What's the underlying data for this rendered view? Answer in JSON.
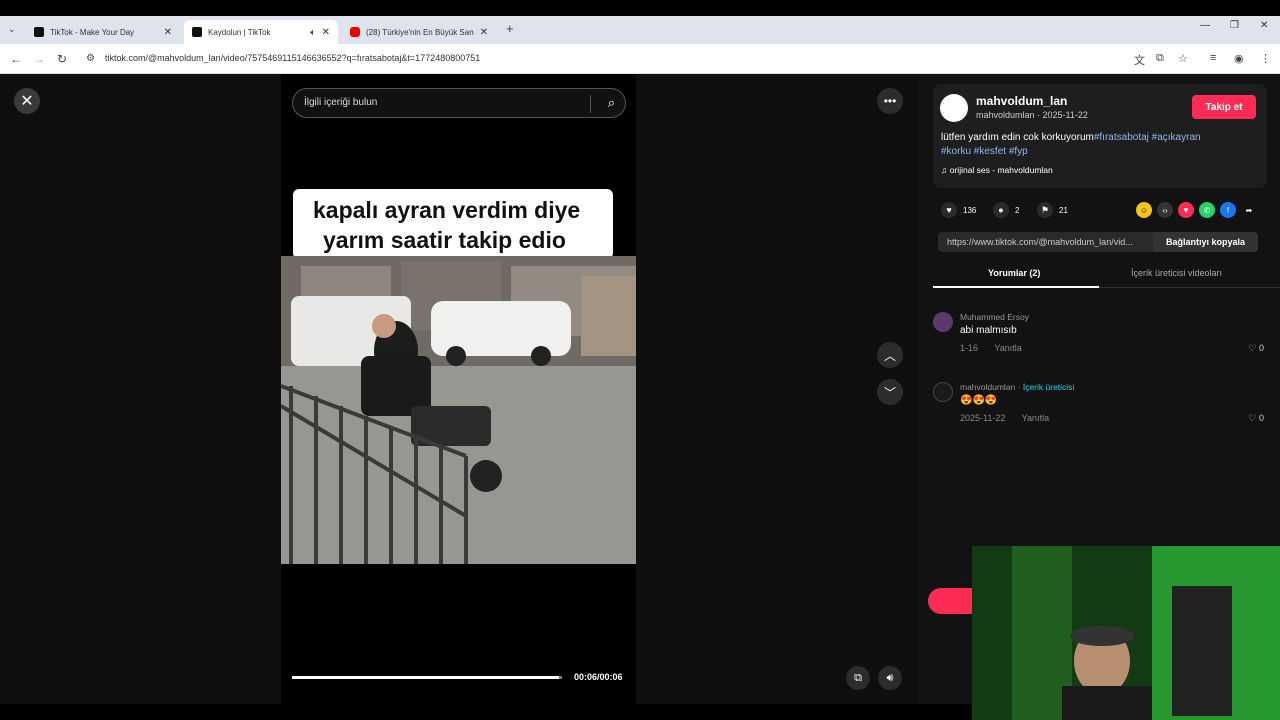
{
  "browser": {
    "tabs": [
      {
        "title": "TikTok - Make Your Day"
      },
      {
        "title": "Kaydolun | TikTok"
      },
      {
        "title": "(28) Türkiye'nin En Büyük Sand"
      }
    ],
    "new_tab": "+",
    "url": "tiktok.com/@mahvoldum_lan/video/7575469115146636552?q=fıratsabotaj&t=1772480800751"
  },
  "player": {
    "search_placeholder": "İlgili içeriği bulun",
    "caption_line1": "kapalı ayran verdim diye",
    "caption_line2": "yarım saatir takip edio",
    "time": "00:06/00:06",
    "progress": 0.99
  },
  "profile": {
    "username": "mahvoldum_lan",
    "subline": "mahvoldumlan · 2025-11-22",
    "follow_label": "Takip et",
    "description": "lütfen yardım edin cok korkuyorum",
    "hashtags_line1": "#fıratsabotaj #açıkayran",
    "hashtags_line2": "#korku #kesfet #fyp",
    "music": "orijinal ses - mahvoldumlan"
  },
  "stats": {
    "likes": "136",
    "comments": "2",
    "saves": "21"
  },
  "share": {
    "link": "https://www.tiktok.com/@mahvoldum_lan/vid...",
    "copy_label": "Bağlantıyı kopyala"
  },
  "tabs": {
    "comments": "Yorumlar (2)",
    "creator_videos": "İçerik üreticisi videoları"
  },
  "comments": [
    {
      "name": "Muhammed Ersoy",
      "text": "abi malmısıb",
      "date": "1-16",
      "reply": "Yanıtla",
      "likes": "0"
    },
    {
      "name": "mahvoldumlan",
      "badge": "İçerik üreticisi",
      "text": "😍😍😍",
      "date": "2025-11-22",
      "reply": "Yanıtla",
      "likes": "0"
    }
  ],
  "colors": {
    "accent": "#fe2c55",
    "hashtag": "#8fb8f0",
    "creator_badge": "#20d5ec"
  }
}
